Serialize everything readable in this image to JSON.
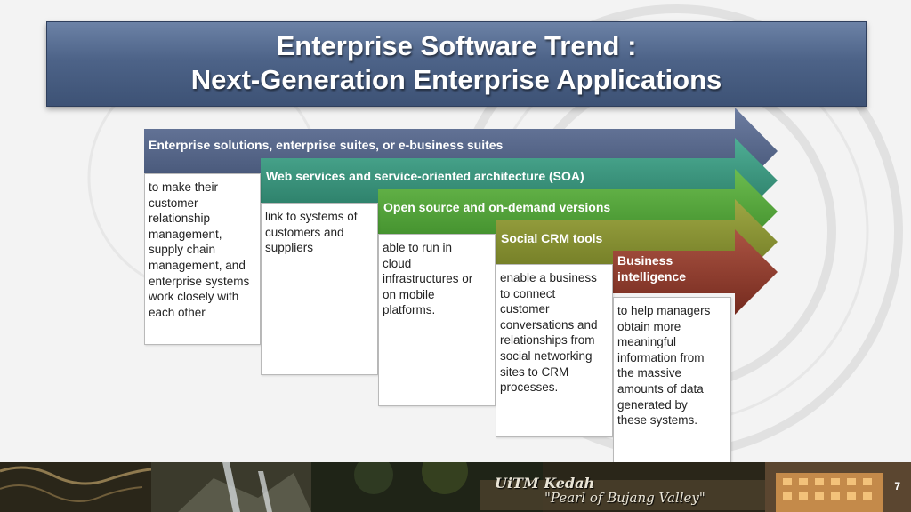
{
  "slide": {
    "title_line1": "Enterprise Software Trend :",
    "title_line2": "Next-Generation Enterprise Applications",
    "page_number": "7"
  },
  "steps": [
    {
      "header": "Enterprise solutions, enterprise suites, or e-business suites",
      "desc_lines": [
        "to make their",
        "customer",
        "relationship",
        "management,",
        "supply chain",
        "management, and",
        "enterprise systems",
        "work closely with",
        "each other"
      ],
      "color": "#4b5b7d"
    },
    {
      "header": "Web services and service-oriented architecture (SOA)",
      "desc_lines": [
        "link to systems of",
        "customers and",
        "suppliers"
      ],
      "color": "#2f8c75"
    },
    {
      "header": "Open source and on-demand versions",
      "desc_lines": [
        "able to run in",
        "cloud",
        "infrastructures or",
        "on mobile",
        "platforms."
      ],
      "color": "#4a9a34"
    },
    {
      "header": "Social CRM tools",
      "desc_lines": [
        "enable a business",
        "to connect",
        "customer",
        "conversations and",
        "relationships from",
        "social networking",
        "sites to CRM",
        "processes."
      ],
      "color": "#7f8a2a"
    },
    {
      "header_lines": [
        "Business",
        "intelligence"
      ],
      "desc_lines": [
        "to help managers",
        "obtain more",
        "meaningful",
        "information from",
        "the massive",
        "amounts of data",
        "generated by",
        "these systems."
      ],
      "color": "#8a3a2c"
    }
  ],
  "footer": {
    "brand": "UiTM Kedah",
    "tagline": "\"Pearl of Bujang Valley\""
  }
}
